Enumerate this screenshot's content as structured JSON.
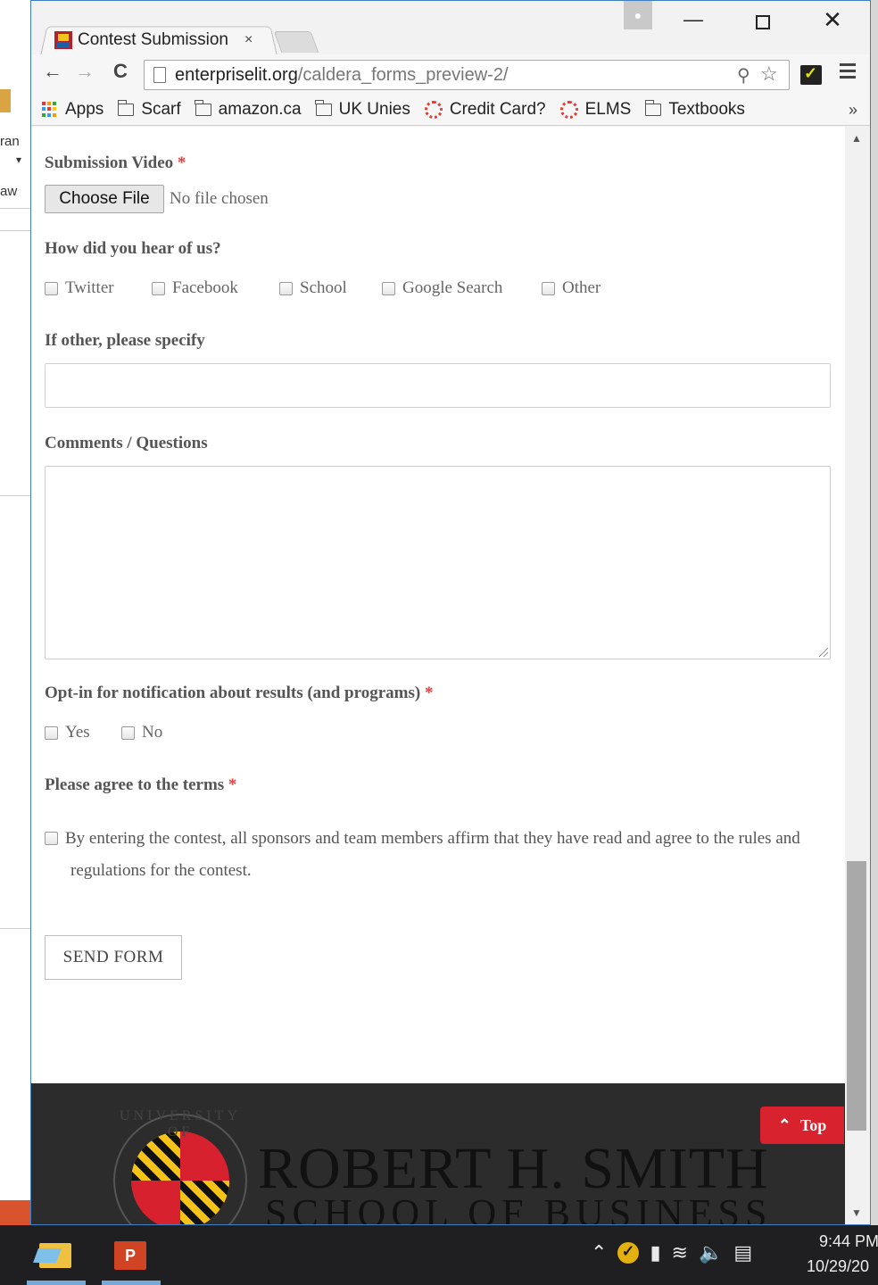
{
  "background_windows": {
    "text_1": "ran",
    "text_2": "aw"
  },
  "browser": {
    "tab": {
      "title": "Contest Submission",
      "close": "×"
    },
    "window_controls": {
      "minimize": "—",
      "maximize": "",
      "close": "✕"
    },
    "nav": {
      "back": "←",
      "forward": "→",
      "reload": "C"
    },
    "url": {
      "host": "enterpriselit.org",
      "path": "/caldera_forms_preview-2/"
    },
    "bookmarks": [
      {
        "label": "Apps",
        "icon": "apps-grid-icon"
      },
      {
        "label": "Scarf",
        "icon": "folder-icon"
      },
      {
        "label": "amazon.ca",
        "icon": "folder-icon"
      },
      {
        "label": "UK Unies",
        "icon": "folder-icon"
      },
      {
        "label": "Credit Card?",
        "icon": "ring-icon"
      },
      {
        "label": "ELMS",
        "icon": "ring-icon"
      },
      {
        "label": "Textbooks",
        "icon": "folder-icon"
      }
    ],
    "bookmarks_more": "»"
  },
  "form": {
    "submission_video": {
      "label": "Submission Video",
      "required": "*",
      "button": "Choose File",
      "status": "No file chosen"
    },
    "hear_about": {
      "label": "How did you hear of us?",
      "options": [
        "Twitter",
        "Facebook",
        "School",
        "Google Search",
        "Other"
      ]
    },
    "other_specify": {
      "label": "If other, please specify",
      "value": ""
    },
    "comments": {
      "label": "Comments / Questions",
      "value": ""
    },
    "opt_in": {
      "label": "Opt-in for notification about results (and programs)",
      "required": "*",
      "options": [
        "Yes",
        "No"
      ]
    },
    "terms": {
      "label": "Please agree to the terms",
      "required": "*",
      "text": "By entering the contest, all sponsors and team members affirm that they have read and agree to the rules and regulations for the contest."
    },
    "submit": "SEND FORM"
  },
  "footer": {
    "seal_text": "UNIVERSITY OF",
    "brand_line_1": "ROBERT H. SMITH",
    "brand_line_2": "SCHOOL OF BUSINESS",
    "top_button": "Top"
  },
  "taskbar": {
    "ppt_label": "P",
    "time": "9:44 PM",
    "date": "10/29/20"
  },
  "colors": {
    "accent_red": "#d8232f",
    "required_red": "#e24040",
    "footer_bg": "#2c2c2c"
  }
}
